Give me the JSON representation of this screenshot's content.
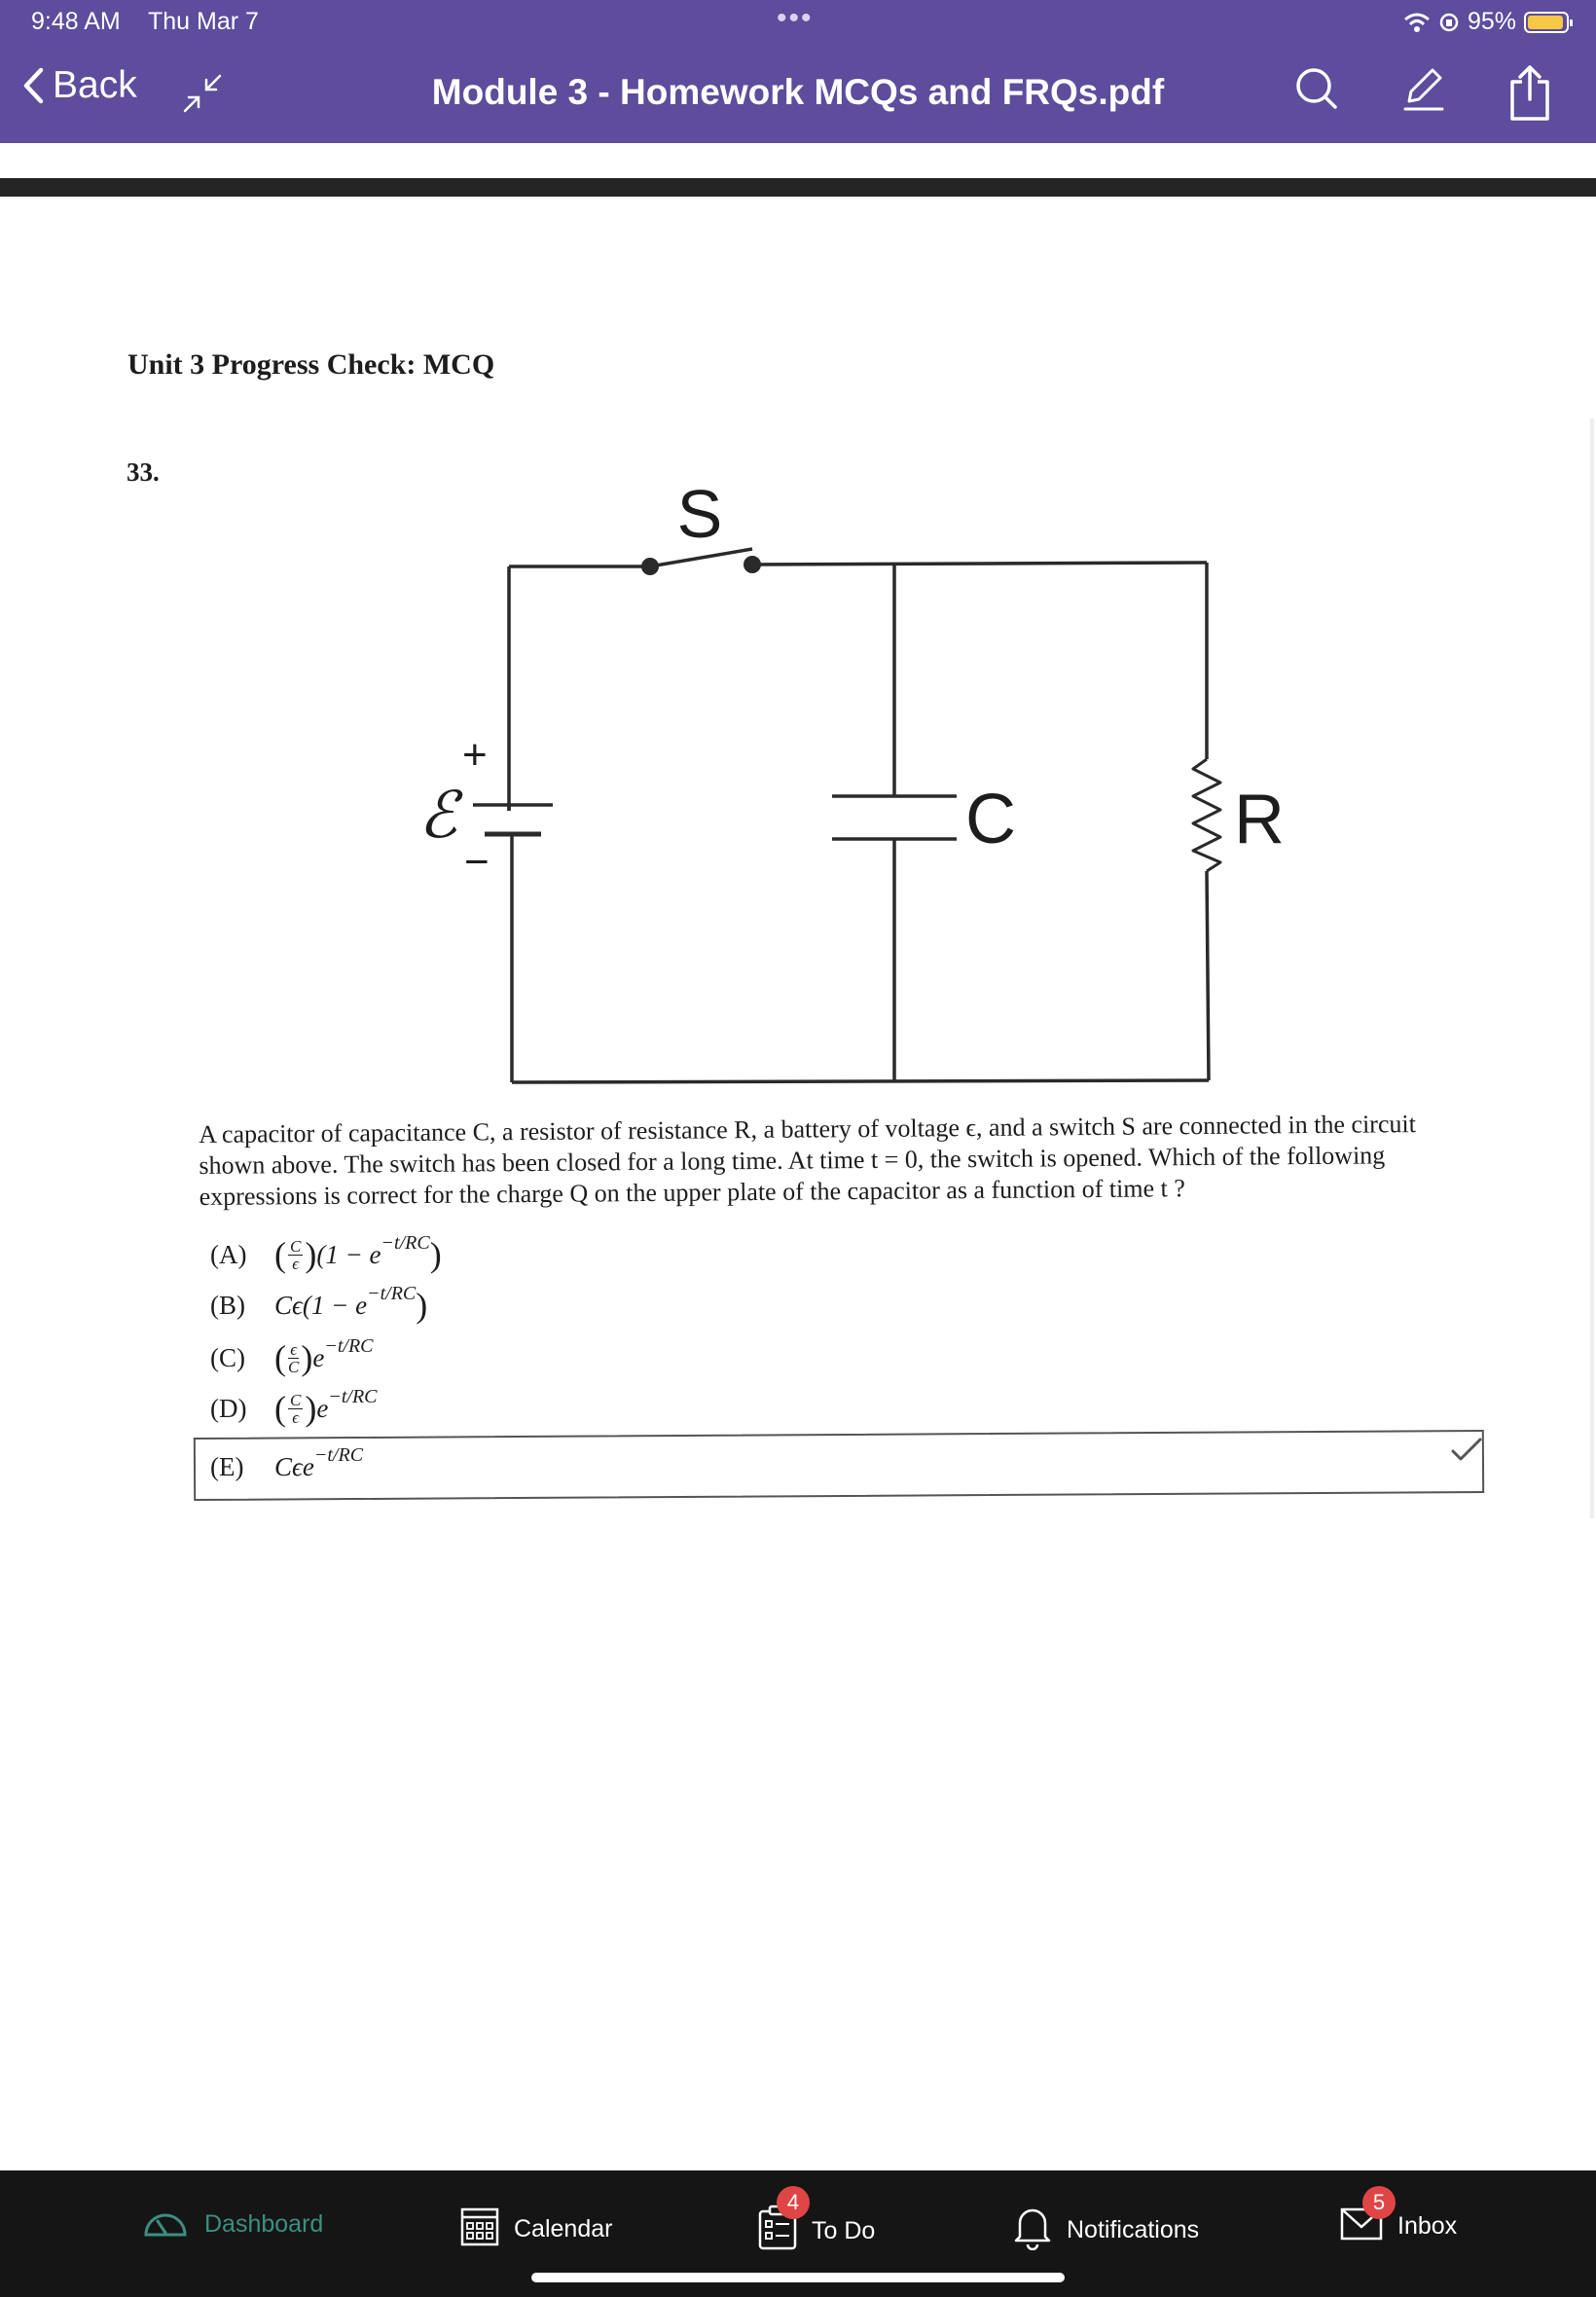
{
  "status_bar": {
    "time": "9:48 AM",
    "date": "Thu Mar 7",
    "battery": "95%",
    "battery_level": 0.95
  },
  "header": {
    "back_label": "Back",
    "title": "Module 3 - Homework MCQs and FRQs.pdf",
    "icons": [
      "collapse-icon",
      "search-icon",
      "markup-pen-icon",
      "share-icon"
    ],
    "background_color": "#5e4c9c"
  },
  "document": {
    "heading": "Unit 3 Progress Check: MCQ",
    "question_number": "33.",
    "circuit_labels": {
      "switch": "S",
      "emf": "ℰ",
      "plus": "+",
      "minus": "−",
      "capacitor": "C",
      "resistor": "R"
    },
    "question_text": "A capacitor of capacitance C, a resistor of resistance R, a battery of voltage ϵ, and a switch S are connected in the circuit shown above. The switch has been closed for a long time. At time t = 0, the switch is opened. Which of the following expressions is correct for the charge Q on the upper plate of the capacitor as a function of time t ?",
    "answers": [
      {
        "letter": "(A)",
        "expr": "(C/ϵ)(1 − e^(−t/RC))",
        "frac_num": "C",
        "frac_den": "ϵ",
        "tail": "(1 − e",
        "exp": "−t/RC",
        "close": ")"
      },
      {
        "letter": "(B)",
        "expr": "Cϵ(1 − e^(−t/RC))",
        "lead": "Cϵ(1 − e",
        "exp": "−t/RC",
        "close": ")"
      },
      {
        "letter": "(C)",
        "expr": "(ϵ/C)e^(−t/RC)",
        "frac_num": "ϵ",
        "frac_den": "C",
        "tail": "e",
        "exp": "−t/RC"
      },
      {
        "letter": "(D)",
        "expr": "(C/ϵ)e^(−t/RC)",
        "frac_num": "C",
        "frac_den": "ϵ",
        "tail": "e",
        "exp": "−t/RC"
      },
      {
        "letter": "(E)",
        "expr": "Cϵe^(−t/RC)",
        "lead": "Cϵe",
        "exp": "−t/RC",
        "selected": true
      }
    ]
  },
  "tab_bar": {
    "tabs": [
      {
        "label": "Dashboard",
        "icon": "dashboard-icon",
        "active": true
      },
      {
        "label": "Calendar",
        "icon": "calendar-icon"
      },
      {
        "label": "To Do",
        "icon": "todo-icon",
        "badge": "4"
      },
      {
        "label": "Notifications",
        "icon": "bell-icon"
      },
      {
        "label": "Inbox",
        "icon": "inbox-icon",
        "badge": "5"
      }
    ],
    "active_color": "#3b8f82",
    "badge_color": "#e04545"
  }
}
